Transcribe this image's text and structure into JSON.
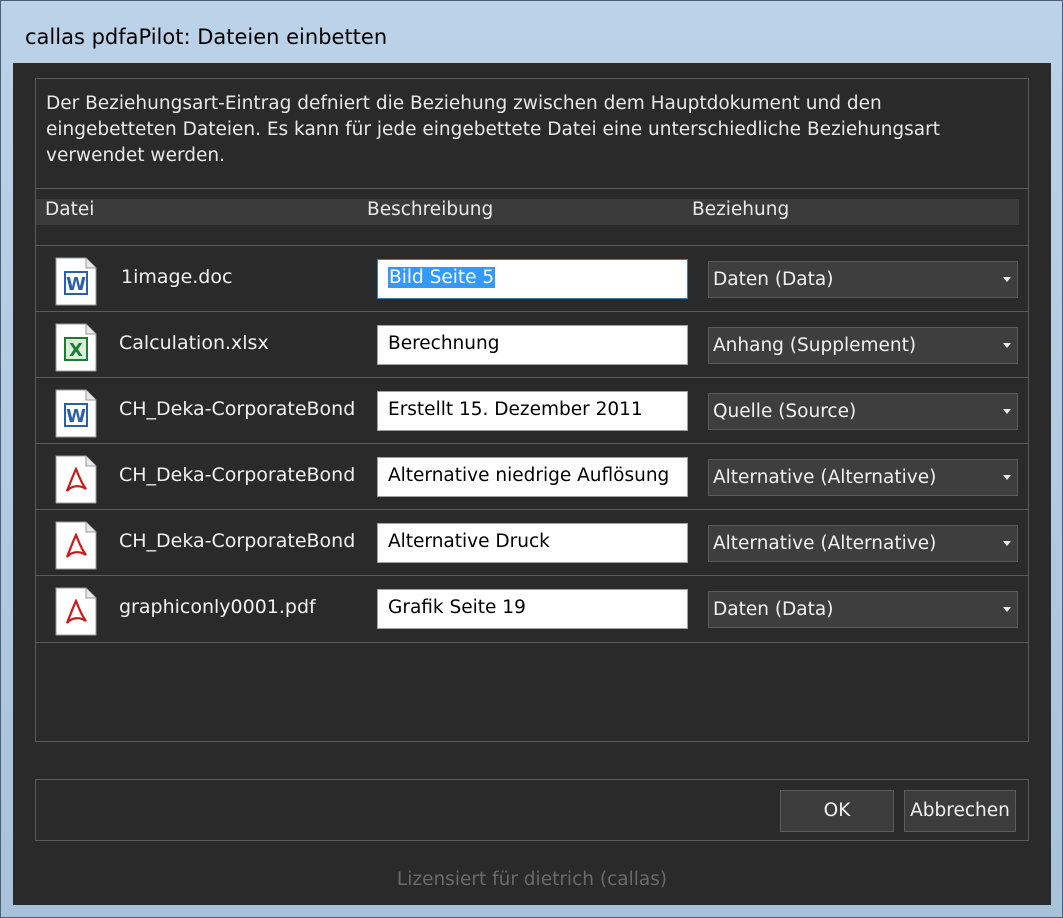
{
  "window": {
    "title": "callas pdfaPilot: Dateien einbetten"
  },
  "description": "Der Beziehungsart-Eintrag defniert die Beziehung zwischen dem Hauptdokument und den eingebetteten Dateien. Es kann für jede eingebettete Datei eine unterschiedliche Beziehungsart verwendet werden.",
  "columns": {
    "file": "Datei",
    "description": "Beschreibung",
    "relationship": "Beziehung"
  },
  "files": [
    {
      "name": "1image.doc",
      "icon": "word-document-icon",
      "description": "Bild Seite 5",
      "relationship": "Daten (Data)"
    },
    {
      "name": "Calculation.xlsx",
      "icon": "excel-spreadsheet-icon",
      "description": "Berechnung",
      "relationship": "Anhang (Supplement)"
    },
    {
      "name": "CH_Deka-CorporateBond",
      "icon": "word-document-icon",
      "description": "Erstellt 15. Dezember 2011",
      "relationship": "Quelle (Source)"
    },
    {
      "name": "CH_Deka-CorporateBond",
      "icon": "pdf-document-icon",
      "description": "Alternative niedrige Auflösung",
      "relationship": "Alternative (Alternative)"
    },
    {
      "name": "CH_Deka-CorporateBond",
      "icon": "pdf-document-icon",
      "description": "Alternative Druck",
      "relationship": "Alternative (Alternative)"
    },
    {
      "name": "graphiconly0001.pdf",
      "icon": "pdf-document-icon",
      "description": "Grafik Seite 19",
      "relationship": "Daten (Data)"
    }
  ],
  "buttons": {
    "ok": "OK",
    "cancel": "Abbrechen"
  },
  "license": "Lizensiert für dietrich (callas)",
  "colors": {
    "background": "#2a2a2a",
    "selection": "#3399ff",
    "word_blue": "#2a5fb0",
    "excel_green": "#1e7b34",
    "pdf_red": "#d01818"
  }
}
